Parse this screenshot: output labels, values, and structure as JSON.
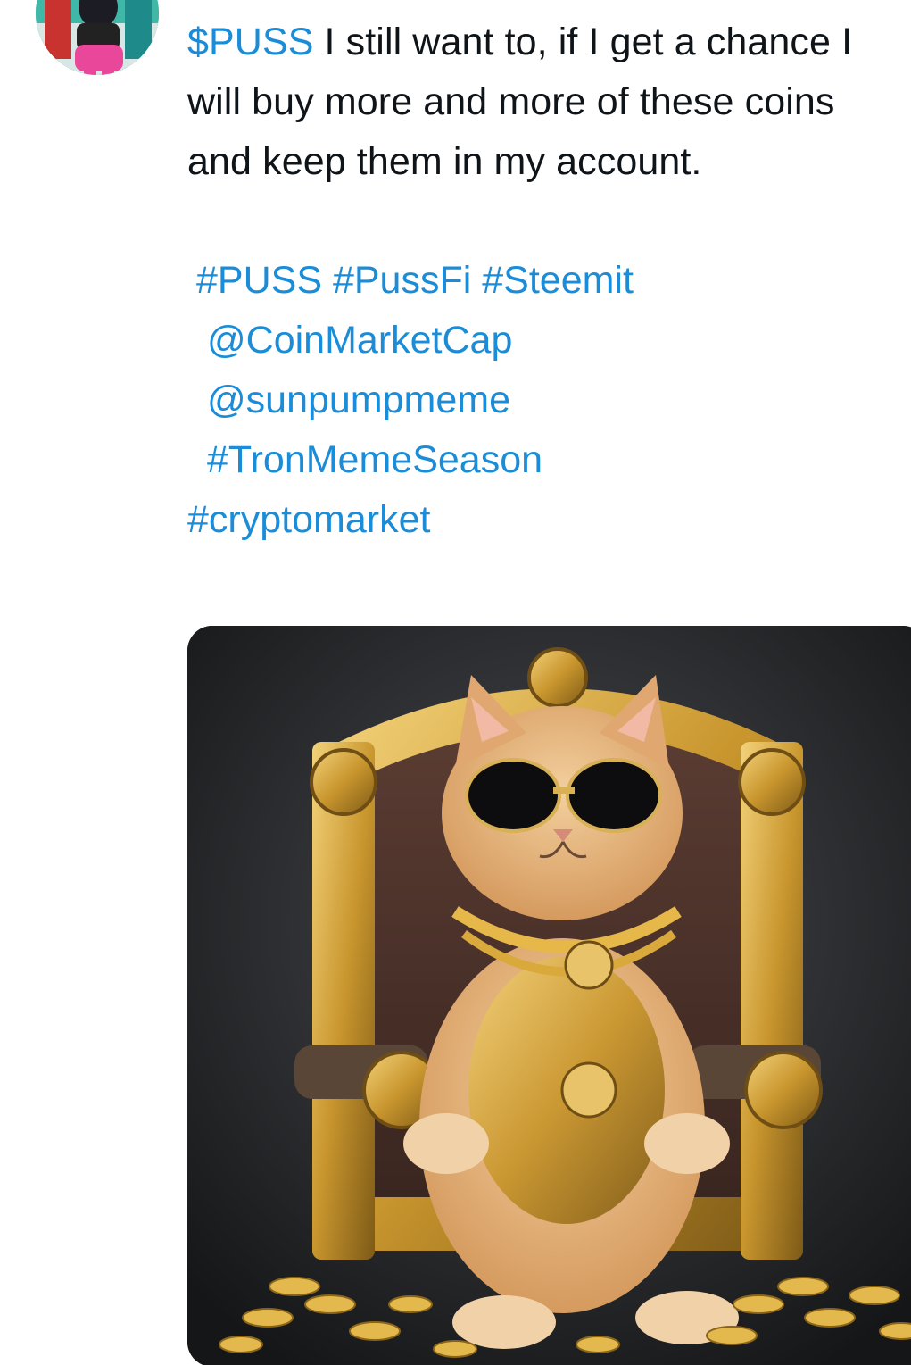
{
  "tweet": {
    "cashtag": "$PUSS",
    "text": " I still want to, if I get a chance I will buy more and more of these coins and keep them in my account.",
    "tags_line1": "#PUSS #PussFi #Steemit",
    "mention1": "@CoinMarketCap",
    "mention2": "@sunpumpmeme",
    "tag_line4": "#TronMemeSeason",
    "tag_line5": "#cryptomarket"
  },
  "media": {
    "description_icon": "image-icon"
  },
  "colors": {
    "link": "#1a8cd8",
    "text": "#0f1419"
  }
}
